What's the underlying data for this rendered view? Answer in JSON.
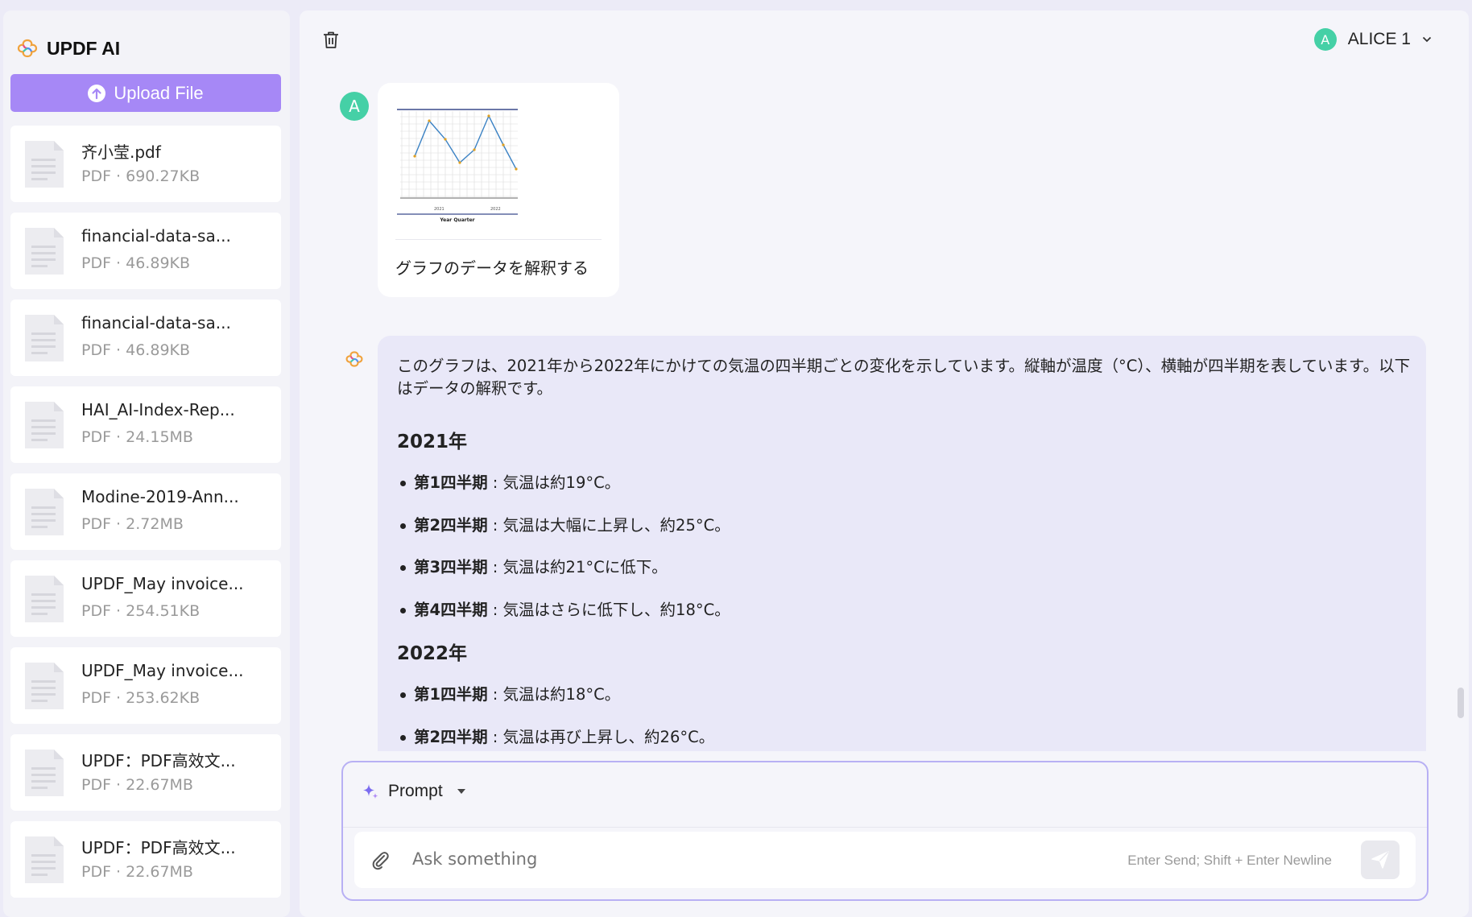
{
  "app": {
    "name": "UPDF AI"
  },
  "sidebar": {
    "upload_label": "Upload File",
    "files": [
      {
        "name": "齐小莹.pdf",
        "meta": "PDF · 690.27KB"
      },
      {
        "name": "financial-data-sa...",
        "meta": "PDF · 46.89KB"
      },
      {
        "name": "financial-data-sa...",
        "meta": "PDF · 46.89KB"
      },
      {
        "name": "HAI_AI-Index-Rep...",
        "meta": "PDF · 24.15MB"
      },
      {
        "name": "Modine-2019-Ann...",
        "meta": "PDF · 2.72MB"
      },
      {
        "name": "UPDF_May invoice...",
        "meta": "PDF · 254.51KB"
      },
      {
        "name": "UPDF_May invoice...",
        "meta": "PDF · 253.62KB"
      },
      {
        "name": "UPDF：PDF高效文...",
        "meta": "PDF · 22.67MB"
      },
      {
        "name": "UPDF：PDF高效文...",
        "meta": "PDF · 22.67MB"
      }
    ]
  },
  "header": {
    "user_initial": "A",
    "user_name": "ALICE 1"
  },
  "chat": {
    "user_initial": "A",
    "user_message": "グラフのデータを解釈する",
    "ai_intro": "このグラフは、2021年から2022年にかけての気温の四半期ごとの変化を示しています。縦軸が温度（°C）、横軸が四半期を表しています。以下はデータの解釈です。",
    "sections": [
      {
        "heading": "2021年",
        "items": [
          {
            "label": "第1四半期",
            "text": " : 気温は約19°C。"
          },
          {
            "label": "第2四半期",
            "text": " : 気温は大幅に上昇し、約25°C。"
          },
          {
            "label": "第3四半期",
            "text": " : 気温は約21°Cに低下。"
          },
          {
            "label": "第4四半期",
            "text": " : 気温はさらに低下し、約18°C。"
          }
        ]
      },
      {
        "heading": "2022年",
        "items": [
          {
            "label": "第1四半期",
            "text": " : 気温は約18°C。"
          },
          {
            "label": "第2四半期",
            "text": " : 気温は再び上昇し、約26°C。"
          }
        ]
      }
    ],
    "thumbnail": {
      "xlabel": "Year Quarter",
      "tick_labels": [
        "2021",
        "2022"
      ]
    }
  },
  "composer": {
    "prompt_label": "Prompt",
    "placeholder": "Ask something",
    "hint": "Enter Send; Shift + Enter Newline"
  },
  "colors": {
    "accent": "#a688f6",
    "avatar": "#45d0a6",
    "ai_bubble": "#e9e8f8"
  }
}
